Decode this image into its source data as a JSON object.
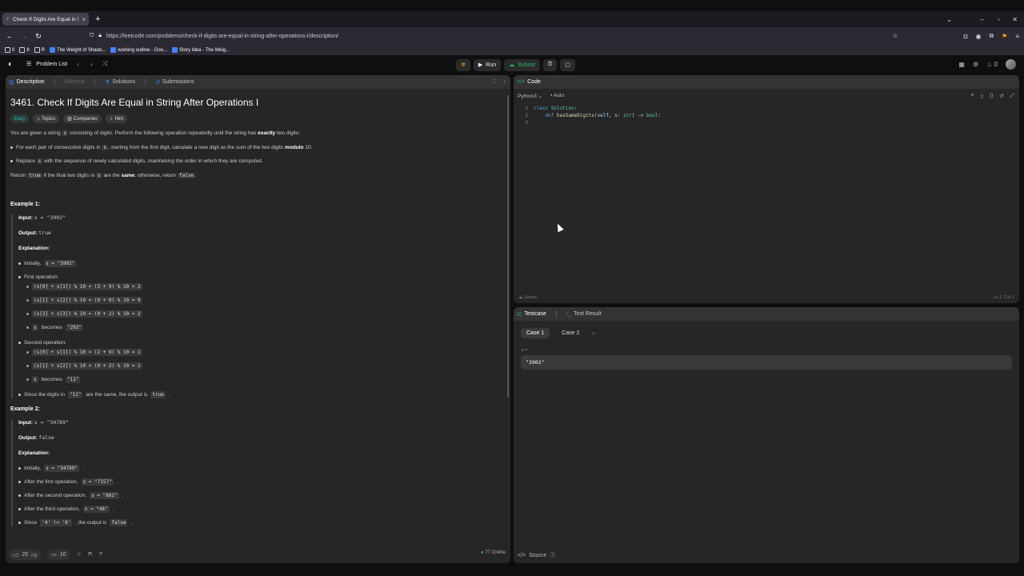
{
  "browser": {
    "tab_title": "Check If Digits Are Equal in Strin",
    "url": "https://leetcode.com/problems/check-if-digits-are-equal-in-string-after-operations-i/description/",
    "bookmarks": [
      {
        "label": "0",
        "color": "#fbfbfe"
      },
      {
        "label": "8",
        "color": "#fbfbfe"
      },
      {
        "label": "R",
        "color": "#fbfbfe"
      },
      {
        "label": "The Weight of Shado...",
        "color": "#4285f4"
      },
      {
        "label": "working outline - Goo...",
        "color": "#4285f4"
      },
      {
        "label": "Story Idea - The Weig...",
        "color": "#4285f4"
      }
    ]
  },
  "header": {
    "problem_list": "Problem List",
    "run": "Run",
    "submit": "Submit",
    "streak": "0"
  },
  "left": {
    "tabs": {
      "description": "Description",
      "editorial": "Editorial",
      "solutions": "Solutions",
      "submissions": "Submissions"
    },
    "title": "3461. Check If Digits Are Equal in String After Operations I",
    "chips": {
      "difficulty": "Easy",
      "topics": "Topics",
      "companies": "Companies",
      "hint": "Hint"
    },
    "intro_1": "You are given a string",
    "intro_code": "s",
    "intro_2": "consisting of digits. Perform the following operation repeatedly until the string has",
    "intro_bold": "exactly",
    "intro_3": "two digits:",
    "bullet1_a": "For each pair of consecutive digits in",
    "bullet1_code": "s",
    "bullet1_b": ", starting from the first digit, calculate a new digit as the sum of the two digits",
    "bullet1_bold": "modulo",
    "bullet1_c": "10.",
    "bullet2_a": "Replace",
    "bullet2_code": "s",
    "bullet2_b": "with the sequence of newly calculated digits,",
    "bullet2_em": "maintaining the order",
    "bullet2_c": "in which they are computed.",
    "return_a": "Return",
    "return_true": "true",
    "return_b": "if the final two digits in",
    "return_s": "s",
    "return_c": "are the",
    "return_bold": "same",
    "return_d": "; otherwise, return",
    "return_false": "false",
    "return_e": ".",
    "ex1": {
      "title": "Example 1:",
      "input_label": "Input:",
      "input": "s = \"3902\"",
      "output_label": "Output:",
      "output": "true",
      "explanation": "Explanation:",
      "initially": "Initially,",
      "initially_code": "s = \"3902\"",
      "first_op": "First operation:",
      "ops1": [
        "(s[0] + s[1]) % 10 = (3 + 9) % 10 = 2",
        "(s[1] + s[2]) % 10 = (9 + 0) % 10 = 9",
        "(s[2] + s[3]) % 10 = (0 + 2) % 10 = 2"
      ],
      "becomes1_s": "s",
      "becomes1": "becomes",
      "becomes1_code": "\"292\"",
      "second_op": "Second operation:",
      "ops2": [
        "(s[0] + s[1]) % 10 = (2 + 9) % 10 = 1",
        "(s[1] + s[2]) % 10 = (9 + 2) % 10 = 1"
      ],
      "becomes2_s": "s",
      "becomes2": "becomes",
      "becomes2_code": "\"11\"",
      "since_a": "Since the digits in",
      "since_code": "\"11\"",
      "since_b": "are the same, the output is",
      "since_true": "true",
      "since_c": "."
    },
    "ex2": {
      "title": "Example 2:",
      "input_label": "Input:",
      "input": "s = \"34789\"",
      "output_label": "Output:",
      "output": "false",
      "explanation": "Explanation:",
      "l1_a": "Initially,",
      "l1_code": "s = \"34789\"",
      "l1_b": ".",
      "l2_a": "After the first operation,",
      "l2_code": "s = \"7157\"",
      "l2_b": ".",
      "l3_a": "After the second operation,",
      "l3_code": "s = \"862\"",
      "l3_b": ".",
      "l4_a": "After the third operation,",
      "l4_code": "s = \"48\"",
      "l4_b": ".",
      "l5_a": "Since",
      "l5_code": "'4' != '8'",
      "l5_b": ", the output is",
      "l5_false": "false",
      "l5_c": "."
    },
    "bottom": {
      "likes": "25",
      "comments": "10",
      "online": "77 Online"
    }
  },
  "code": {
    "tab": "Code",
    "language": "Python3",
    "auto": "Auto",
    "lines": [
      "1",
      "2",
      "3"
    ],
    "saved": "Saved",
    "cursor_pos": "Ln 1, Col 1"
  },
  "tests": {
    "tab_testcase": "Testcase",
    "tab_result": "Test Result",
    "case1": "Case 1",
    "case2": "Case 2",
    "var_label": "s =",
    "value": "\"3902\"",
    "source": "Source"
  }
}
